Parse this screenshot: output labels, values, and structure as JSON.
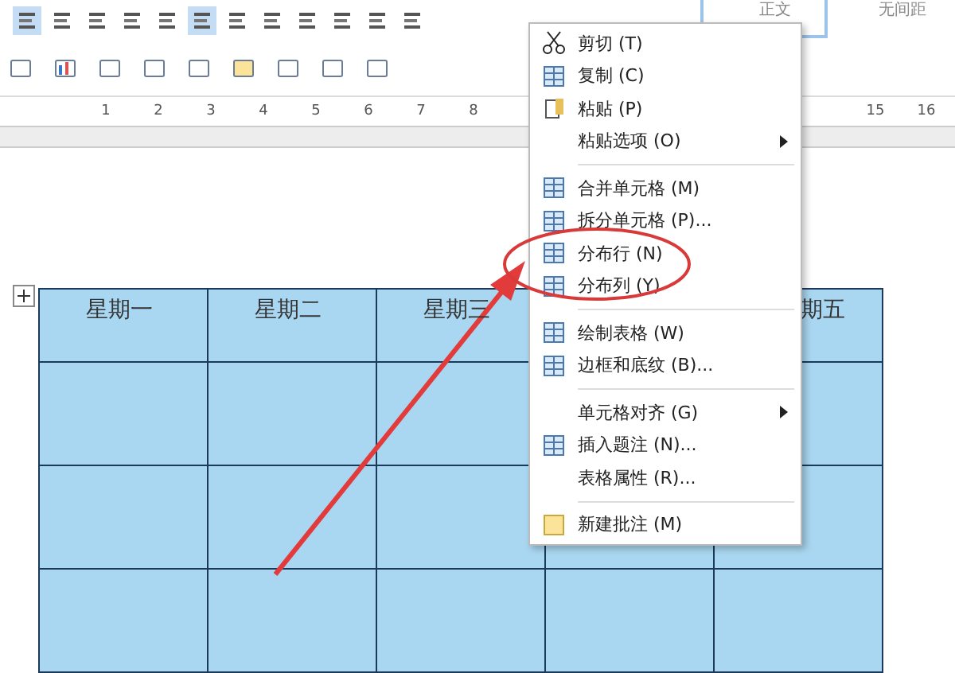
{
  "styles_gallery": [
    {
      "label": "正文",
      "selected": true
    },
    {
      "label": "无间距",
      "selected": false
    }
  ],
  "ruler": {
    "left_labels": [
      "1",
      "2",
      "3",
      "4",
      "5",
      "6",
      "7",
      "8"
    ],
    "right_labels": [
      "15",
      "16"
    ]
  },
  "table": {
    "columns": [
      {
        "header": "星期一"
      },
      {
        "header": "星期二"
      },
      {
        "header": "星期三"
      },
      {},
      {
        "header": "期五"
      }
    ]
  },
  "context_menu": [
    {
      "kind": "item",
      "label": "剪切 (T)",
      "submenu": false
    },
    {
      "kind": "item",
      "label": "复制 (C)",
      "submenu": false
    },
    {
      "kind": "item",
      "label": "粘贴 (P)",
      "submenu": false
    },
    {
      "kind": "item",
      "label": "粘贴选项 (O)",
      "submenu": true
    },
    {
      "kind": "separator"
    },
    {
      "kind": "item",
      "label": "合并单元格 (M)",
      "submenu": false
    },
    {
      "kind": "item",
      "label": "拆分单元格 (P)...",
      "submenu": false
    },
    {
      "kind": "item",
      "label": "分布行 (N)",
      "submenu": false
    },
    {
      "kind": "item",
      "label": "分布列 (Y)",
      "submenu": false
    },
    {
      "kind": "separator"
    },
    {
      "kind": "item",
      "label": "绘制表格 (W)",
      "submenu": false
    },
    {
      "kind": "item",
      "label": "边框和底纹 (B)...",
      "submenu": false
    },
    {
      "kind": "separator"
    },
    {
      "kind": "item",
      "label": "单元格对齐 (G)",
      "submenu": true
    },
    {
      "kind": "item",
      "label": "插入题注 (N)...",
      "submenu": false
    },
    {
      "kind": "item",
      "label": "表格属性 (R)...",
      "submenu": false
    },
    {
      "kind": "separator"
    },
    {
      "kind": "item",
      "label": "新建批注 (M)",
      "submenu": false
    }
  ]
}
